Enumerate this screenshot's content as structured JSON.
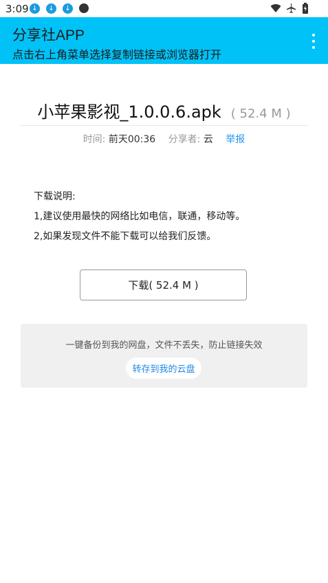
{
  "status_bar": {
    "time": "3:09",
    "notification_icons": [
      "download-icon",
      "download-icon",
      "download-icon",
      "dot-icon"
    ],
    "system_icons": [
      "wifi-icon",
      "airplane-mode-icon",
      "battery-icon"
    ]
  },
  "appbar": {
    "title": "分享社APP",
    "subtitle": "点击右上角菜单选择复制链接或浏览器打开",
    "background_color": "#00c2f7"
  },
  "file": {
    "name": "小苹果影视_1.0.0.6.apk",
    "size": "( 52.4 M )",
    "time_label": "时间:",
    "time_value": "前天00:36",
    "sharer_label": "分享者:",
    "sharer_value": "云",
    "report_label": "举报"
  },
  "description": {
    "heading": "下载说明:",
    "line1": "1,建议使用最快的网络比如电信，联通，移动等。",
    "line2": "2,如果发现文件不能下载可以给我们反馈。"
  },
  "download_button": {
    "label": "下载( 52.4 M )"
  },
  "save_card": {
    "text": "一键备份到我的网盘，文件不丢失，防止链接失效",
    "button_label": "转存到我的云盘"
  },
  "colors": {
    "link": "#2196f3",
    "accent": "#00c2f7"
  }
}
